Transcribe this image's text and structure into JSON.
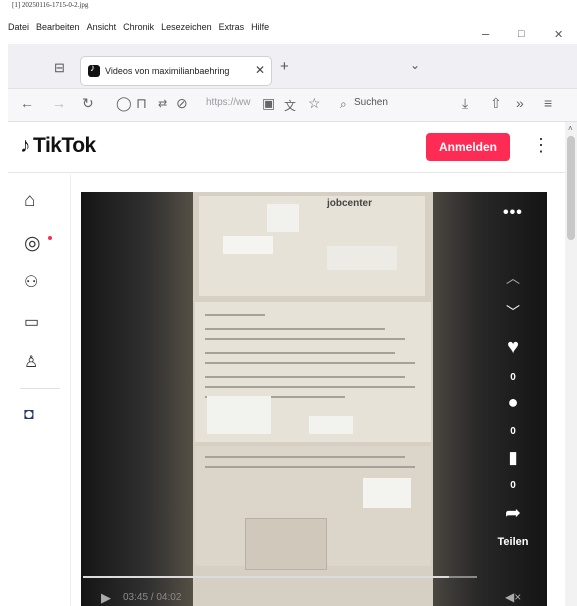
{
  "file_label": "[1] 20250116-1715-0-2.jpg",
  "menu": [
    "Datei",
    "Bearbeiten",
    "Ansicht",
    "Chronik",
    "Lesezeichen",
    "Extras",
    "Hilfe"
  ],
  "window_controls": {
    "minimize": "–",
    "maximize": "□",
    "close": "✕"
  },
  "tab": {
    "title": "Videos von maximilianbaehring",
    "close": "✕"
  },
  "new_tab": "+",
  "nav": {
    "url": "https://ww",
    "search_label": "Suchen"
  },
  "tiktok": {
    "logo_text": "TikTok",
    "login_label": "Anmelden",
    "document_header": "jobcenter",
    "actions": {
      "like_count": "0",
      "comment_count": "0",
      "save_count": "0",
      "share_label": "Teilen"
    },
    "time": "03:45 / 04:02",
    "progress": 0.93
  },
  "colors": {
    "accent": "#fe2c55",
    "player_bg": "#101010"
  },
  "icons": {
    "sidebar": [
      "home-icon",
      "explore-icon",
      "following-icon",
      "live-icon",
      "profile-icon",
      "creator-avatar-icon"
    ]
  }
}
